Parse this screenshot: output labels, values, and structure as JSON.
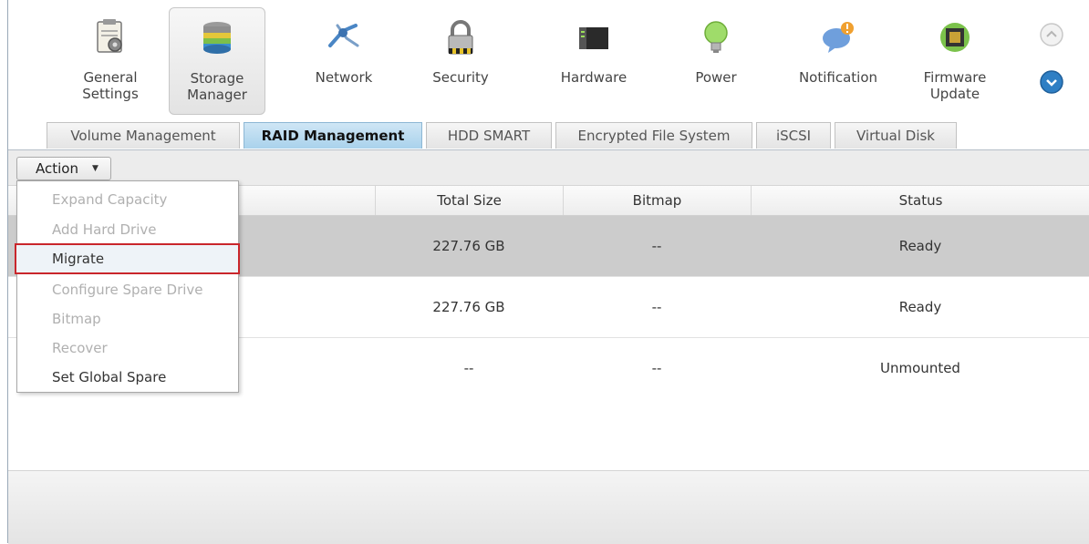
{
  "top_nav": {
    "items": [
      {
        "label": "General\nSettings",
        "icon": "general-settings-icon"
      },
      {
        "label": "Storage\nManager",
        "icon": "storage-manager-icon",
        "active": true
      },
      {
        "label": "Network",
        "icon": "network-icon"
      },
      {
        "label": "Security",
        "icon": "lock-icon"
      },
      {
        "label": "Hardware",
        "icon": "hardware-icon"
      },
      {
        "label": "Power",
        "icon": "lightbulb-icon"
      },
      {
        "label": "Notification",
        "icon": "notification-icon"
      },
      {
        "label": "Firmware\nUpdate",
        "icon": "firmware-icon"
      }
    ]
  },
  "tabs": [
    {
      "label": "Volume Management"
    },
    {
      "label": "RAID Management",
      "active": true
    },
    {
      "label": "HDD SMART"
    },
    {
      "label": "Encrypted File System"
    },
    {
      "label": "iSCSI"
    },
    {
      "label": "Virtual Disk"
    }
  ],
  "toolbar": {
    "action_label": "Action"
  },
  "table": {
    "columns": [
      "Total Size",
      "Bitmap",
      "Status"
    ],
    "rows": [
      {
        "total_size": "227.76 GB",
        "bitmap": "--",
        "status": "Ready"
      },
      {
        "total_size": "227.76 GB",
        "bitmap": "--",
        "status": "Ready"
      },
      {
        "total_size": "--",
        "bitmap": "--",
        "status": "Unmounted"
      }
    ]
  },
  "action_menu": {
    "items": [
      {
        "label": "Expand Capacity",
        "enabled": false
      },
      {
        "label": "Add Hard Drive",
        "enabled": false
      },
      {
        "label": "Migrate",
        "enabled": true,
        "highlighted": true
      },
      {
        "label": "Configure Spare Drive",
        "enabled": false
      },
      {
        "label": "Bitmap",
        "enabled": false
      },
      {
        "label": "Recover",
        "enabled": false
      },
      {
        "label": "Set Global Spare",
        "enabled": true
      }
    ]
  },
  "colors": {
    "active_tab": "#a9d2ec",
    "selected_row": "#cccccc",
    "highlight_border": "#c9262b",
    "scroll_button": "#2f7fc4"
  }
}
